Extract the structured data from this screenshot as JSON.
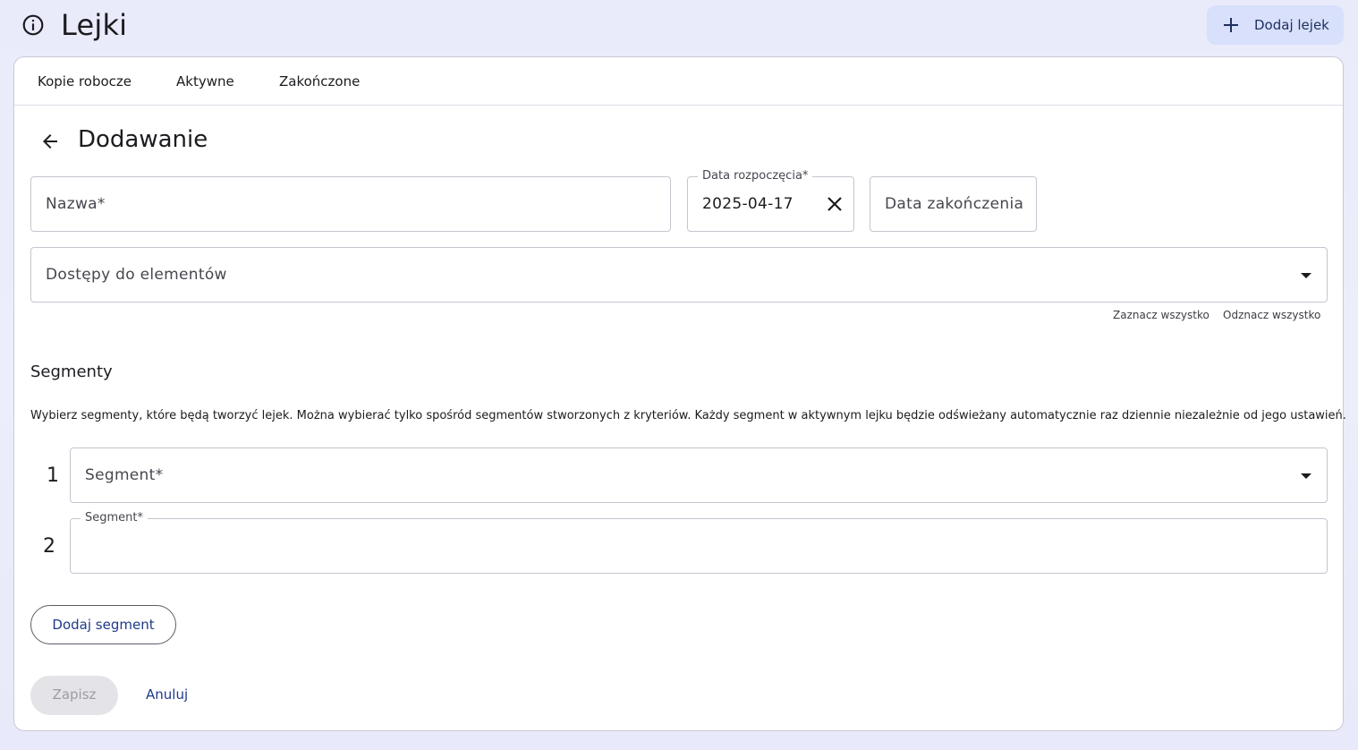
{
  "header": {
    "title": "Lejki",
    "info_icon": "info-icon",
    "add_button_label": "Dodaj lejek",
    "add_button_icon": "plus-icon"
  },
  "tabs": [
    {
      "label": "Kopie robocze"
    },
    {
      "label": "Aktywne"
    },
    {
      "label": "Zakończone"
    }
  ],
  "form": {
    "back_icon": "arrow-back-icon",
    "title": "Dodawanie",
    "name_field": {
      "placeholder": "Nazwa",
      "required_mark": "*",
      "value": ""
    },
    "start_date": {
      "label": "Data rozpoczęcia",
      "required_mark": "*",
      "value": "2025-04-17",
      "clear_icon": "close-icon"
    },
    "end_date": {
      "placeholder": "Data zakończenia",
      "value": ""
    },
    "access": {
      "placeholder": "Dostępy do elementów",
      "select_all": "Zaznacz wszystko",
      "deselect_all": "Odznacz wszystko"
    }
  },
  "segments": {
    "title": "Segmenty",
    "description": "Wybierz segmenty, które będą tworzyć lejek. Można wybierać tylko spośród segmentów stworzonych z kryteriów. Każdy segment w aktywnym lejku będzie odświeżany automatycznie raz dziennie niezależnie od jego ustawień.",
    "items": [
      {
        "number": "1",
        "placeholder": "Segment",
        "required_mark": "*"
      },
      {
        "number": "2",
        "label": "Segment",
        "required_mark": "*"
      }
    ],
    "add_button_label": "Dodaj segment"
  },
  "actions": {
    "save_label": "Zapisz",
    "cancel_label": "Anuluj"
  },
  "colors": {
    "accent": "#1f3a8a",
    "add_button_bg": "#d8e0fb",
    "disabled_bg": "#e4e4e8",
    "disabled_text": "#9c9ca3"
  }
}
